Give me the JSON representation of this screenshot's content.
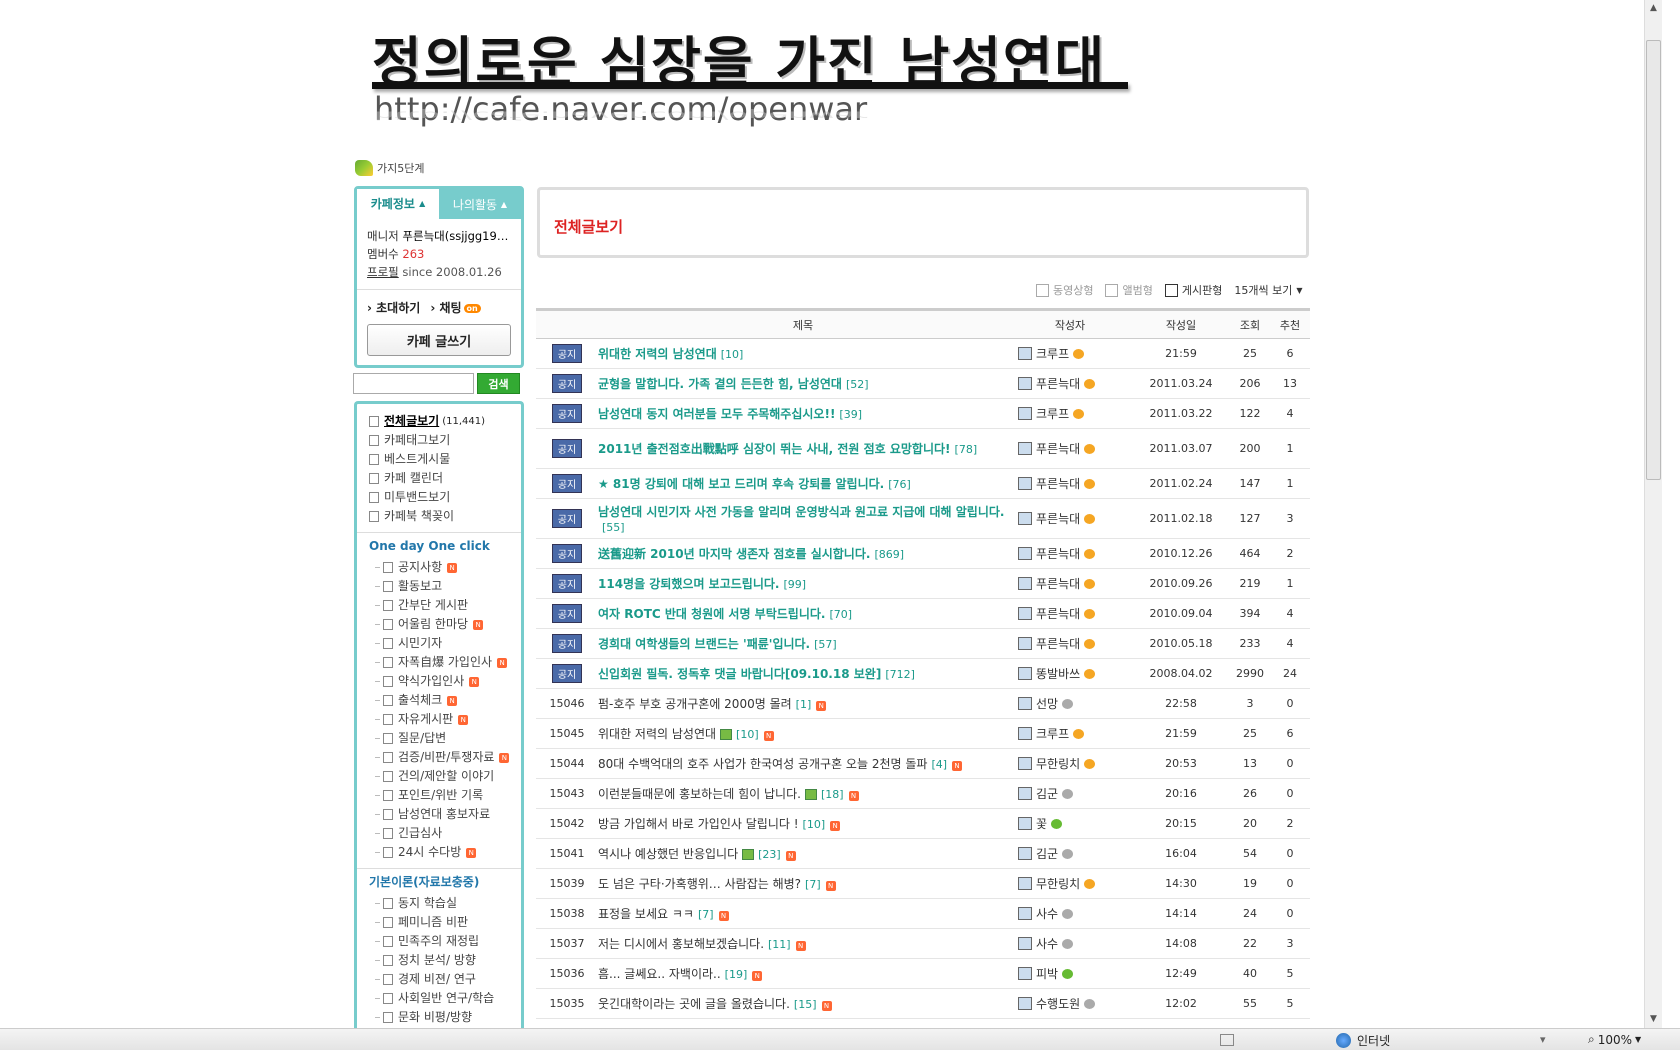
{
  "banner": {
    "title": "정의로운 심장을 가진 남성연대",
    "url": "http://cafe.naver.com/openwar"
  },
  "level": "가지5단계",
  "cafe_box": {
    "tabs": [
      "카페정보",
      "나의활동"
    ],
    "manager_label": "매니저",
    "manager_value": "푸른늑대(ssjjgg19…",
    "members_label": "멤버수",
    "members_value": "263",
    "profile_label": "프로필",
    "since": "since 2008.01.26",
    "invite": "초대하기",
    "chat": "채팅",
    "chat_badge": "on",
    "write_button": "카페 글쓰기"
  },
  "search": {
    "button": "검색",
    "placeholder": ""
  },
  "menu": {
    "top_items": [
      {
        "label": "전체글보기",
        "count": "(11,441)"
      },
      {
        "label": "카페태그보기"
      },
      {
        "label": "베스트게시물"
      },
      {
        "label": "카페 캘린더"
      },
      {
        "label": "미투밴드보기"
      },
      {
        "label": "카페북 책꽂이"
      }
    ],
    "section1_title": "One day One click",
    "section1_items": [
      {
        "label": "공지사항",
        "new": true
      },
      {
        "label": "활동보고",
        "new": false
      },
      {
        "label": "간부단 게시판",
        "new": false
      },
      {
        "label": "어울림 한마당",
        "new": true
      },
      {
        "label": "시민기자",
        "new": false
      },
      {
        "label": "자폭自爆 가입인사",
        "new": true
      },
      {
        "label": "약식가입인사",
        "new": true
      },
      {
        "label": "출석체크",
        "new": true
      },
      {
        "label": "자유게시판",
        "new": true
      },
      {
        "label": "질문/답변",
        "new": false
      },
      {
        "label": "검증/비판/투쟁자료",
        "new": true
      },
      {
        "label": "건의/제안할 이야기",
        "new": false
      },
      {
        "label": "포인트/위반 기록",
        "new": false
      },
      {
        "label": "남성연대 홍보자료",
        "new": false
      },
      {
        "label": "긴급심사",
        "new": false
      },
      {
        "label": "24시 수다방",
        "new": true
      }
    ],
    "section2_title": "기본이론(자료보충중)",
    "section2_items": [
      {
        "label": "동지 학습실"
      },
      {
        "label": "페미니즘 비판"
      },
      {
        "label": "민족주의 재정립"
      },
      {
        "label": "정치 분석/ 방향"
      },
      {
        "label": "경제 비젼/ 연구"
      },
      {
        "label": "사회일반 연구/학습"
      },
      {
        "label": "문화 비평/방향"
      }
    ]
  },
  "main": {
    "page_title": "전체글보기",
    "view_tools": [
      "동영상형",
      "앨범형",
      "게시판형",
      "15개씩 보기"
    ],
    "columns": [
      "제목",
      "작성자",
      "작성일",
      "조회",
      "추천"
    ],
    "notice_badge": "공지",
    "notices": [
      {
        "title": "위대한 저력의 남성연대",
        "comments": "[10]",
        "author": "크루프",
        "medal": "gold",
        "date": "21:59",
        "views": "25",
        "rec": "6",
        "tall": false
      },
      {
        "title": "균형을 말합니다. 가족 곁의 든든한 힘, 남성연대",
        "comments": "[52]",
        "author": "푸른늑대",
        "medal": "gold",
        "date": "2011.03.24",
        "views": "206",
        "rec": "13",
        "tall": false
      },
      {
        "title": "남성연대 동지 여러분들 모두 주목해주십시오!!",
        "comments": "[39]",
        "author": "크루프",
        "medal": "gold",
        "date": "2011.03.22",
        "views": "122",
        "rec": "4",
        "tall": false
      },
      {
        "title": "2011년 출전점호出戰點呼 심장이 뛰는 사내, 전원 점호 요망합니다!",
        "comments": "[78]",
        "author": "푸른늑대",
        "medal": "gold",
        "date": "2011.03.07",
        "views": "200",
        "rec": "1",
        "tall": true
      },
      {
        "title": "★ 81명 강퇴에 대해 보고 드리며 후속 강퇴를 알립니다.",
        "comments": "[76]",
        "author": "푸른늑대",
        "medal": "gold",
        "date": "2011.02.24",
        "views": "147",
        "rec": "1",
        "tall": false
      },
      {
        "title": "남성연대 시민기자 사전 가동을 알리며 운영방식과 원고료 지급에 대해 알립니다.",
        "comments": "[55]",
        "author": "푸른늑대",
        "medal": "gold",
        "date": "2011.02.18",
        "views": "127",
        "rec": "3",
        "tall": true
      },
      {
        "title": "送舊迎新 2010년 마지막 생존자 점호를 실시합니다.",
        "comments": "[869]",
        "author": "푸른늑대",
        "medal": "gold",
        "date": "2010.12.26",
        "views": "464",
        "rec": "2",
        "tall": false
      },
      {
        "title": "114명을 강퇴했으며 보고드립니다.",
        "comments": "[99]",
        "author": "푸른늑대",
        "medal": "gold",
        "date": "2010.09.26",
        "views": "219",
        "rec": "1",
        "tall": false
      },
      {
        "title": "여자 ROTC 반대 청원에 서명 부탁드립니다.",
        "comments": "[70]",
        "author": "푸른늑대",
        "medal": "gold",
        "date": "2010.09.04",
        "views": "394",
        "rec": "4",
        "tall": false
      },
      {
        "title": "경희대 여학생들의 브랜드는 '패륜'입니다.",
        "comments": "[57]",
        "author": "푸른늑대",
        "medal": "gold",
        "date": "2010.05.18",
        "views": "233",
        "rec": "4",
        "tall": false
      },
      {
        "title": "신입회원 필독. 정독후 댓글 바랍니다[09.10.18 보완]",
        "comments": "[712]",
        "author": "똥발바쓰",
        "medal": "gold",
        "date": "2008.04.02",
        "views": "2990",
        "rec": "24",
        "tall": false
      }
    ],
    "posts": [
      {
        "no": "15046",
        "title": "펌-호주 부호 공개구혼에 2000명 몰려",
        "img": false,
        "comments": "[1]",
        "author": "선망",
        "medal": "gray",
        "date": "22:58",
        "views": "3",
        "rec": "0"
      },
      {
        "no": "15045",
        "title": "위대한 저력의 남성연대",
        "img": true,
        "comments": "[10]",
        "author": "크루프",
        "medal": "gold",
        "date": "21:59",
        "views": "25",
        "rec": "6"
      },
      {
        "no": "15044",
        "title": "80대 수백억대의 호주 사업가 한국여성 공개구혼 오늘 2천명 돌파",
        "img": false,
        "comments": "[4]",
        "author": "무한링치",
        "medal": "gold",
        "date": "20:53",
        "views": "13",
        "rec": "0"
      },
      {
        "no": "15043",
        "title": "이런분들때문에 홍보하는데 힘이 납니다.",
        "img": true,
        "comments": "[18]",
        "author": "김군",
        "medal": "gray",
        "date": "20:16",
        "views": "26",
        "rec": "0"
      },
      {
        "no": "15042",
        "title": "방금 가입해서 바로 가입인사 달립니다 !",
        "img": false,
        "comments": "[10]",
        "author": "꽃",
        "medal": "green",
        "date": "20:15",
        "views": "20",
        "rec": "2"
      },
      {
        "no": "15041",
        "title": "역시나 예상했던 반응입니다",
        "img": true,
        "comments": "[23]",
        "author": "김군",
        "medal": "gray",
        "date": "16:04",
        "views": "54",
        "rec": "0"
      },
      {
        "no": "15039",
        "title": "도 넘은 구타·가혹행위… 사람잡는 해병?",
        "img": false,
        "comments": "[7]",
        "author": "무한링치",
        "medal": "gold",
        "date": "14:30",
        "views": "19",
        "rec": "0"
      },
      {
        "no": "15038",
        "title": "표정을 보세요 ㅋㅋ",
        "img": false,
        "comments": "[7]",
        "author": "사수",
        "medal": "gray",
        "date": "14:14",
        "views": "24",
        "rec": "0"
      },
      {
        "no": "15037",
        "title": "저는 디시에서 홍보해보겠습니다.",
        "img": false,
        "comments": "[11]",
        "author": "사수",
        "medal": "gray",
        "date": "14:08",
        "views": "22",
        "rec": "3"
      },
      {
        "no": "15036",
        "title": "흠... 글쎄요.. 자백이라..",
        "img": false,
        "comments": "[19]",
        "author": "피박",
        "medal": "green",
        "date": "12:49",
        "views": "40",
        "rec": "5"
      },
      {
        "no": "15035",
        "title": "웃긴대학이라는 곳에 글을 올렸습니다.",
        "img": false,
        "comments": "[15]",
        "author": "수행도원",
        "medal": "gray",
        "date": "12:02",
        "views": "55",
        "rec": "5"
      }
    ]
  },
  "statusbar": {
    "zone": "인터넷",
    "zoom": "100%"
  }
}
